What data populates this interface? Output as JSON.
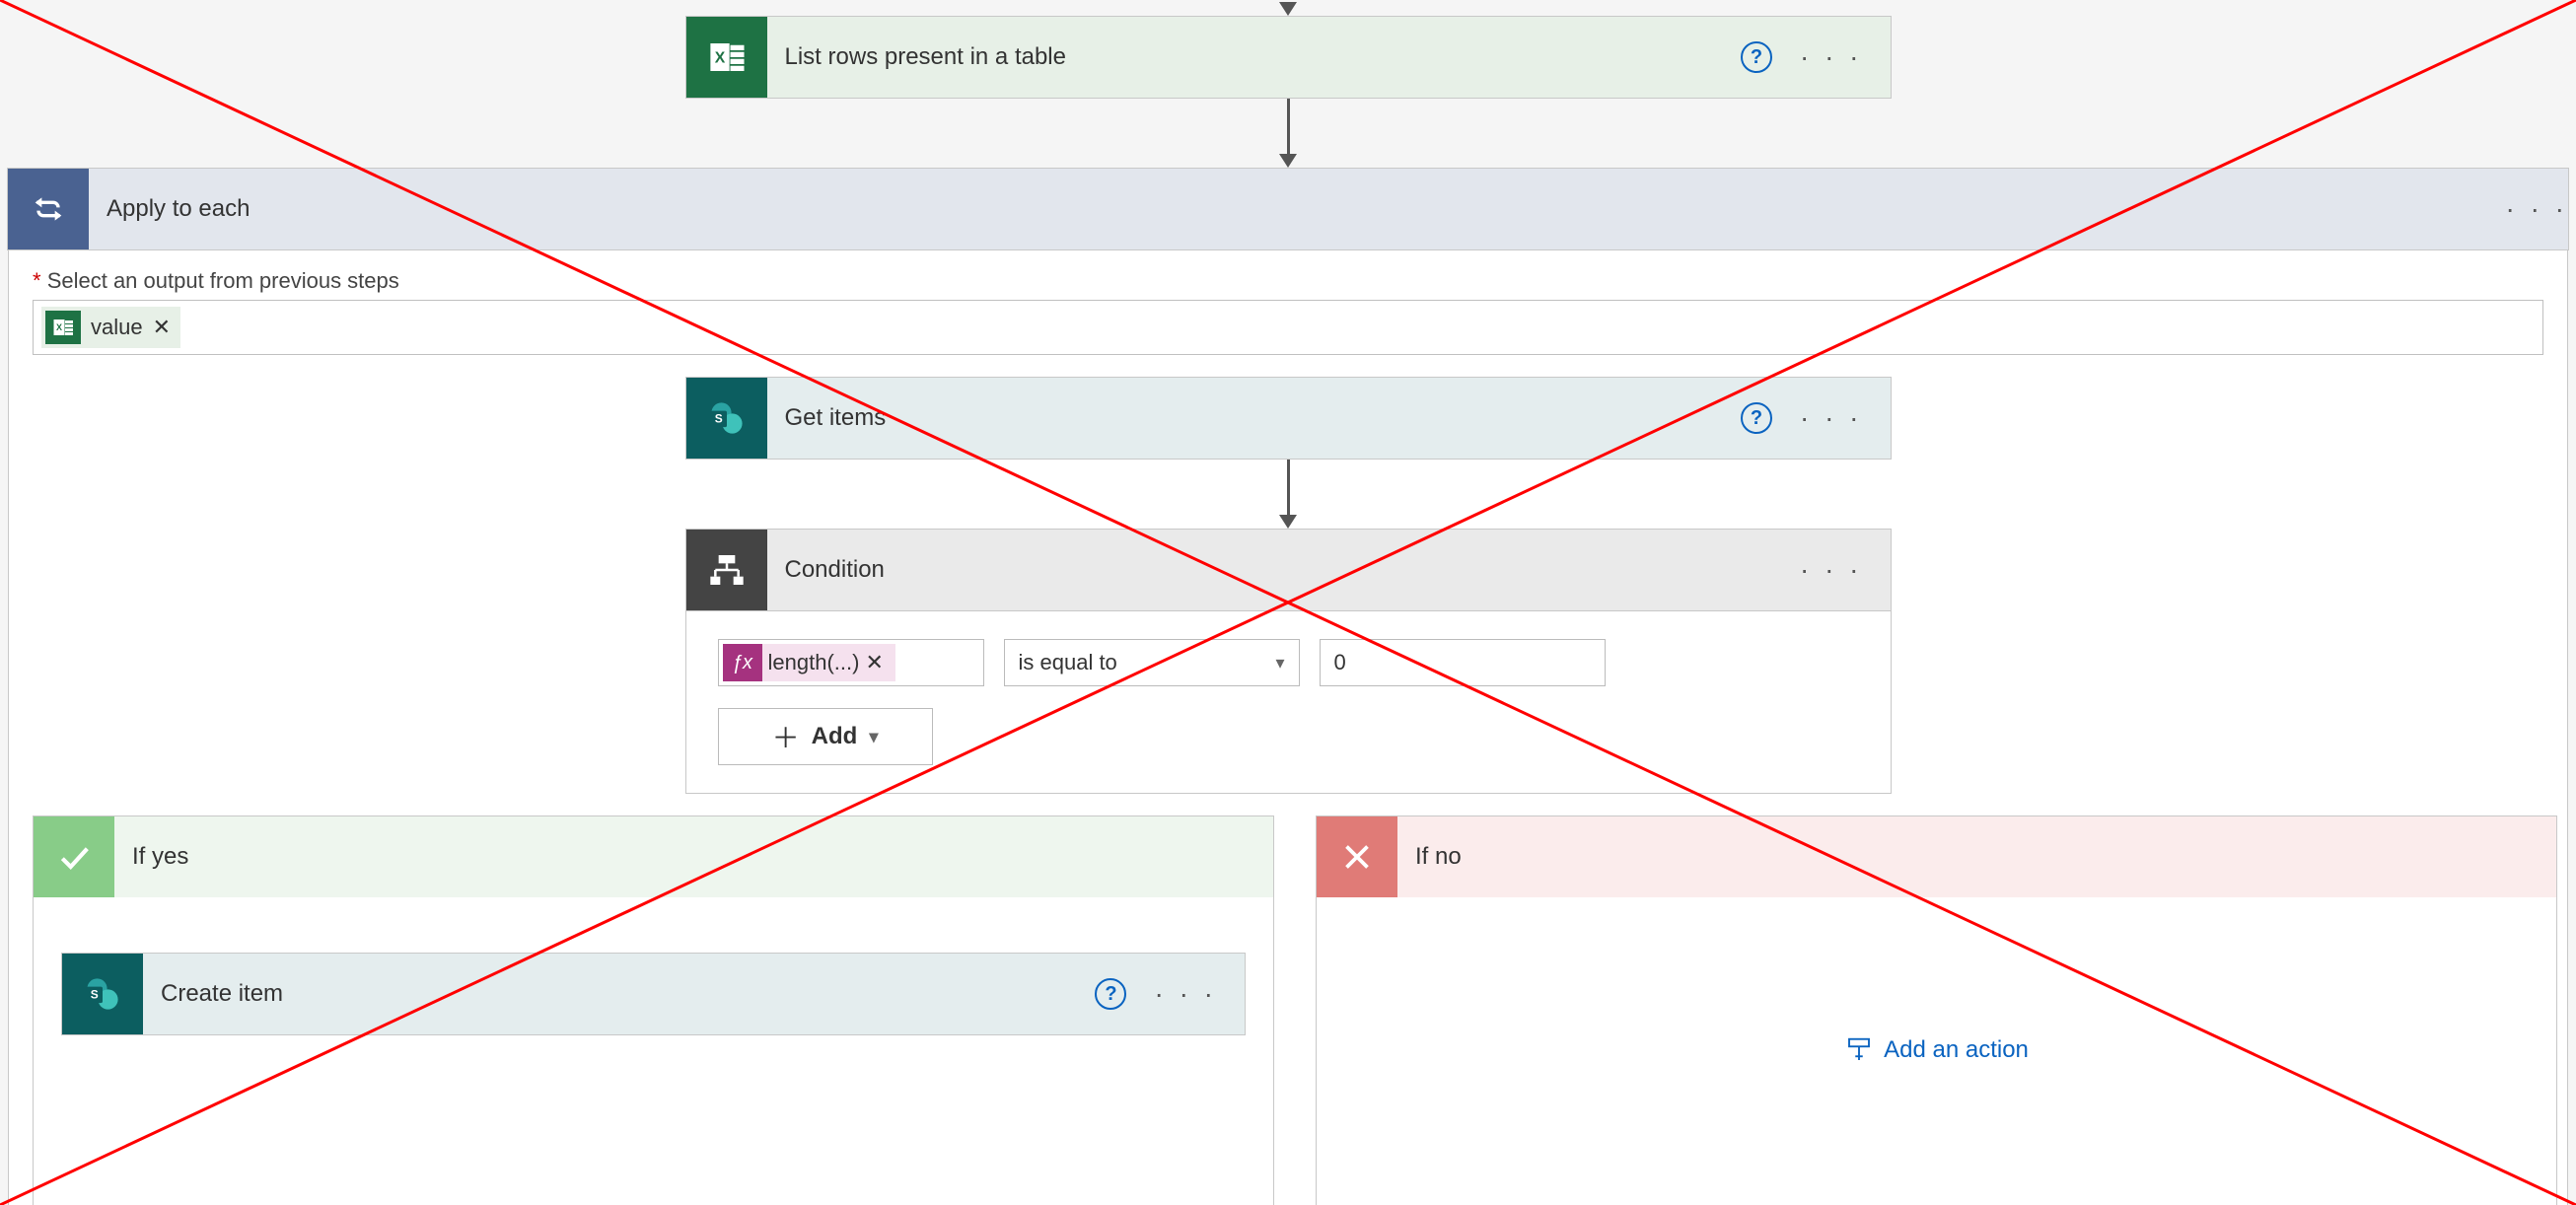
{
  "steps": {
    "excel": {
      "title": "List rows present in a table"
    },
    "apply": {
      "title": "Apply to each",
      "field_label": "Select an output from previous steps",
      "token_label": "value"
    },
    "get_items": {
      "title": "Get items"
    },
    "condition": {
      "title": "Condition",
      "fx_label": "length(...)",
      "operator": "is equal to",
      "value": "0",
      "add_label": "Add"
    },
    "if_yes": {
      "title": "If yes"
    },
    "if_no": {
      "title": "If no"
    },
    "create_item": {
      "title": "Create item"
    },
    "add_action": "Add an action"
  }
}
